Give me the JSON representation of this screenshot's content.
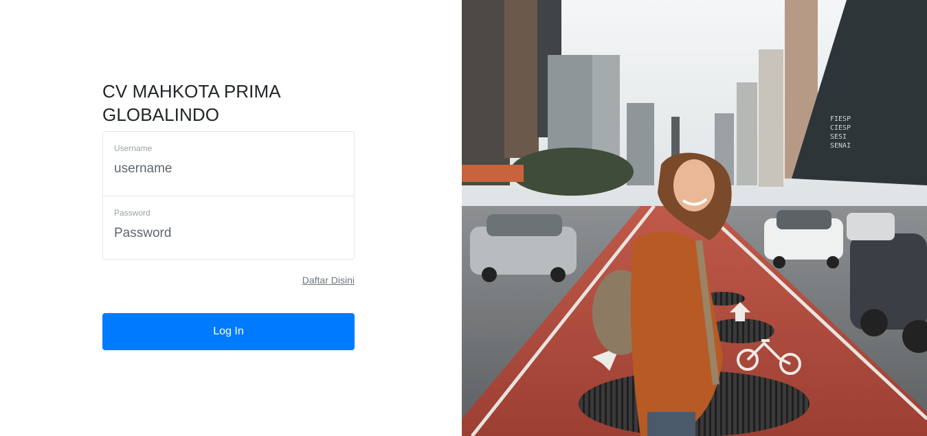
{
  "company": {
    "title_line1": "CV MAHKOTA PRIMA",
    "title_line2": "GLOBALINDO"
  },
  "form": {
    "username": {
      "label": "Username",
      "placeholder": "username"
    },
    "password": {
      "label": "Password",
      "placeholder": "Password"
    },
    "register_link": "Daftar Disini",
    "login_button": "Log In"
  },
  "hero": {
    "building_sign": [
      "FIESP",
      "CIESP",
      "SESI",
      "SENAI"
    ]
  },
  "colors": {
    "primary": "#007bff",
    "bike_lane": "#b3473a",
    "border": "#e3e6ea"
  }
}
